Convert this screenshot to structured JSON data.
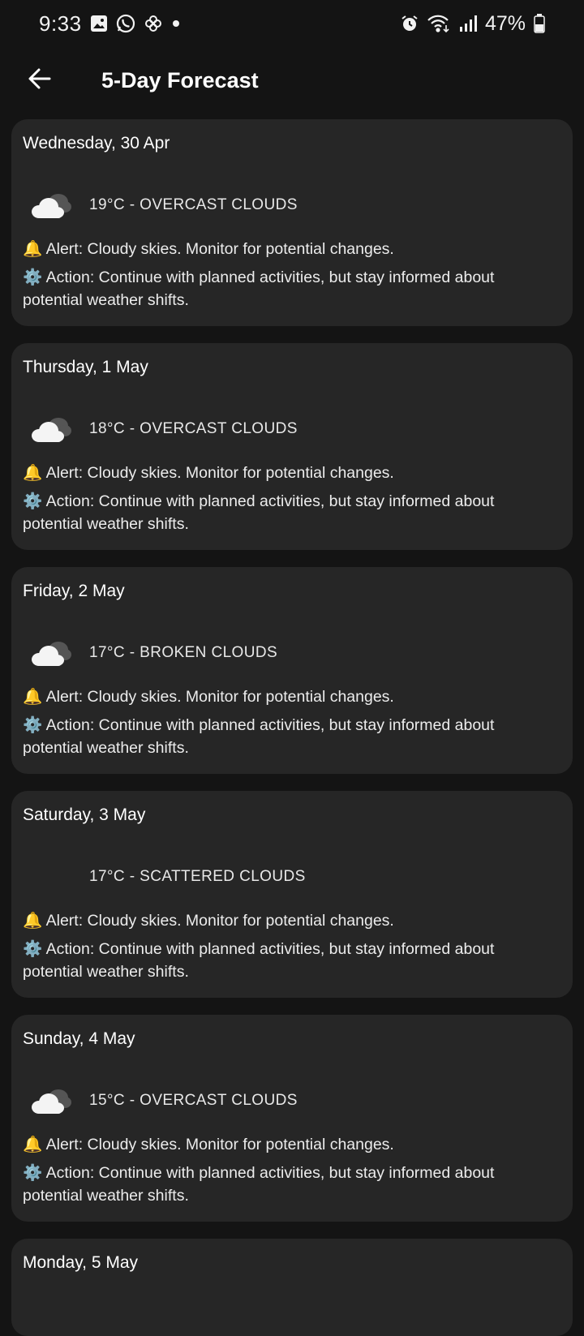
{
  "status_bar": {
    "time": "9:33",
    "battery": "47%",
    "icons_left": [
      "gallery-icon",
      "whatsapp-icon",
      "pinwheel-icon",
      "dot-icon"
    ],
    "icons_right": [
      "alarm-icon",
      "wifi-icon",
      "signal-icon",
      "battery-icon"
    ]
  },
  "header": {
    "title": "5-Day Forecast",
    "back_icon": "arrow-left-icon"
  },
  "forecast": [
    {
      "date": "Wednesday, 30 Apr",
      "condition": "19°C - OVERCAST CLOUDS",
      "alert": "🔔 Alert: Cloudy skies. Monitor for potential changes.",
      "action": "⚙️ Action: Continue with planned activities, but stay informed about potential weather shifts.",
      "icon": "overcast-cloud-icon"
    },
    {
      "date": "Thursday, 1 May",
      "condition": "18°C - OVERCAST CLOUDS",
      "alert": "🔔 Alert: Cloudy skies. Monitor for potential changes.",
      "action": "⚙️ Action: Continue with planned activities, but stay informed about potential weather shifts.",
      "icon": "overcast-cloud-icon"
    },
    {
      "date": "Friday, 2 May",
      "condition": "17°C - BROKEN CLOUDS",
      "alert": "🔔 Alert: Cloudy skies. Monitor for potential changes.",
      "action": "⚙️ Action: Continue with planned activities, but stay informed about potential weather shifts.",
      "icon": "broken-cloud-icon"
    },
    {
      "date": "Saturday, 3 May",
      "condition": "17°C - SCATTERED CLOUDS",
      "alert": "🔔 Alert: Cloudy skies. Monitor for potential changes.",
      "action": "⚙️ Action: Continue with planned activities, but stay informed about potential weather shifts.",
      "icon": ""
    },
    {
      "date": "Sunday, 4 May",
      "condition": "15°C - OVERCAST CLOUDS",
      "alert": "🔔 Alert: Cloudy skies. Monitor for potential changes.",
      "action": "⚙️ Action: Continue with planned activities, but stay informed about potential weather shifts.",
      "icon": "overcast-cloud-icon"
    },
    {
      "date": "Monday, 5 May"
    }
  ],
  "colors": {
    "background": "#141414",
    "card": "#262626",
    "text": "#ffffff"
  }
}
